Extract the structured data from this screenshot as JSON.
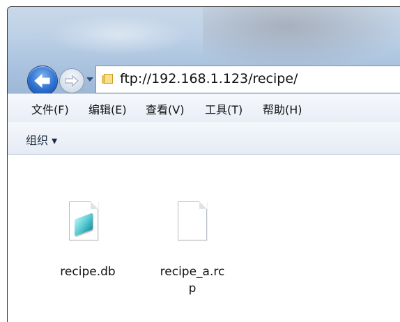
{
  "address": {
    "path": "ftp://192.168.1.123/recipe/"
  },
  "navigation": {
    "back_icon": "arrow-left-icon",
    "forward_icon": "arrow-right-icon",
    "history_dropdown_icon": "chevron-down-icon"
  },
  "menubar": {
    "items": [
      {
        "label": "文件(F)"
      },
      {
        "label": "编辑(E)"
      },
      {
        "label": "查看(V)"
      },
      {
        "label": "工具(T)"
      },
      {
        "label": "帮助(H)"
      }
    ]
  },
  "toolbar": {
    "organize_label": "组织 ▾"
  },
  "files": [
    {
      "name_line1": "recipe.db",
      "name_line2": "",
      "icon": "notepad-document-icon"
    },
    {
      "name_line1": "recipe_a.rc",
      "name_line2": "p",
      "icon": "blank-document-icon"
    }
  ],
  "colors": {
    "titlebar": "#bcd0e6",
    "back_button": "#2d6fd0",
    "address_border": "#7d93b0"
  }
}
